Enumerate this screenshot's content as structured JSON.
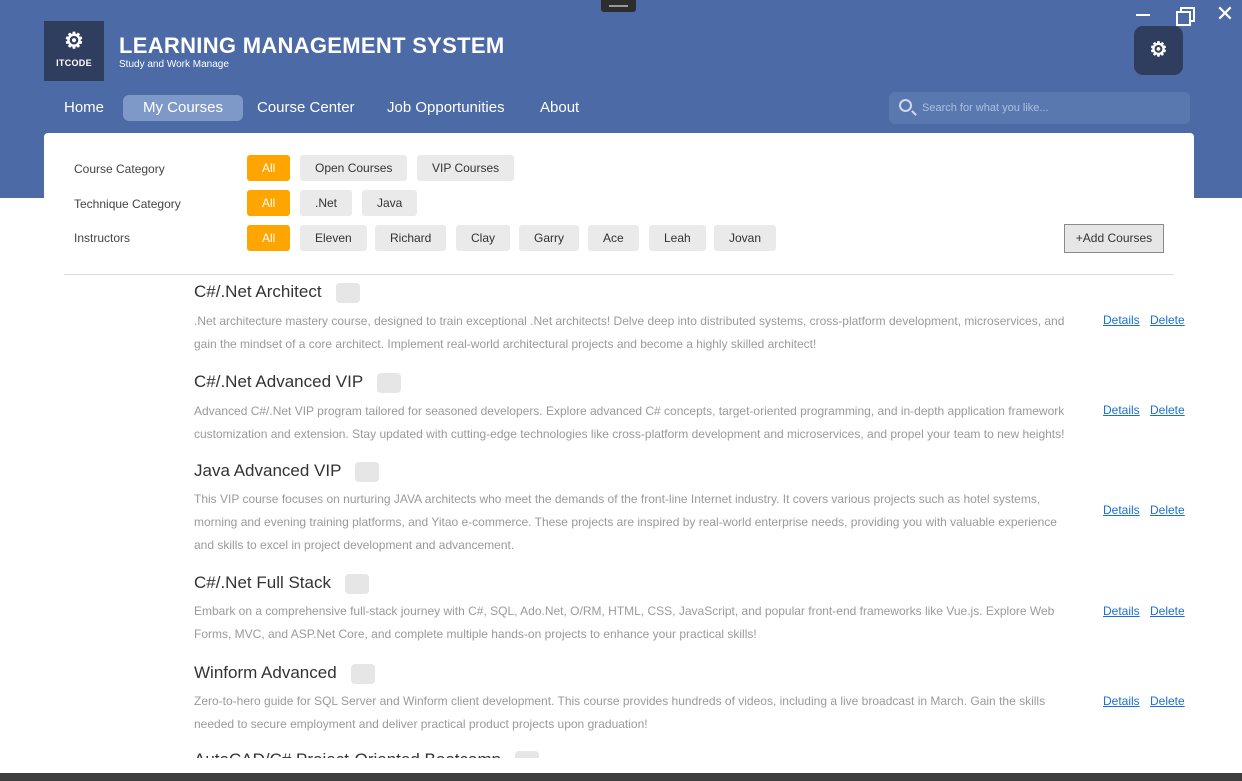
{
  "window": {
    "close_glyph": "✕"
  },
  "header": {
    "logo_glyph": "⚙",
    "logo_text": "ITCODE",
    "title": "LEARNING MANAGEMENT SYSTEM",
    "subtitle": "Study and Work Manage",
    "avatar_glyph": "⚙"
  },
  "nav": {
    "home": "Home",
    "my_courses": "My Courses",
    "course_center": "Course Center",
    "job_opportunities": "Job Opportunities",
    "about": "About"
  },
  "search": {
    "placeholder": "Search for what you like..."
  },
  "filters": {
    "course_category": {
      "label": "Course Category",
      "options": [
        "All",
        "Open Courses",
        "VIP Courses"
      ],
      "selected": "All"
    },
    "technique_category": {
      "label": "Technique Category",
      "options": [
        "All",
        ".Net",
        "Java"
      ],
      "selected": "All"
    },
    "instructors": {
      "label": "Instructors",
      "options": [
        "All",
        "Eleven",
        "Richard",
        "Clay",
        "Garry",
        "Ace",
        "Leah",
        "Jovan"
      ],
      "selected": "All"
    }
  },
  "add_courses_label": "+Add Courses",
  "courses": [
    {
      "title": "C#/.Net Architect",
      "desc_lines": [
        ".Net architecture mastery course, designed to train exceptional .Net architects! Delve deep into distributed systems, cross-platform development, microservices, and",
        "gain the mindset of a core architect. Implement real-world architectural projects and become a highly skilled architect!"
      ],
      "details": "Details",
      "delete": "Delete"
    },
    {
      "title": "C#/.Net Advanced VIP",
      "desc_lines": [
        "Advanced C#/.Net VIP program tailored for seasoned developers. Explore advanced C# concepts, target-oriented programming, and in-depth application framework",
        "customization and extension. Stay updated with cutting-edge technologies like cross-platform development and microservices, and propel your team to new heights!"
      ],
      "details": "Details",
      "delete": "Delete"
    },
    {
      "title": "Java Advanced VIP",
      "desc_lines": [
        "This VIP course focuses on nurturing JAVA architects who meet the demands of the front-line Internet industry. It covers various projects such as hotel systems,",
        "morning and evening training platforms, and Yitao e-commerce. These projects are inspired by real-world enterprise needs, providing you with valuable experience",
        "and skills to excel in project development and advancement."
      ],
      "details": "Details",
      "delete": "Delete"
    },
    {
      "title": "C#/.Net Full Stack",
      "desc_lines": [
        "Embark on a comprehensive full-stack journey with C#, SQL, Ado.Net, O/RM, HTML, CSS, JavaScript, and popular front-end frameworks like Vue.js. Explore Web",
        "Forms, MVC, and ASP.Net Core, and complete multiple hands-on projects to enhance your practical skills!"
      ],
      "details": "Details",
      "delete": "Delete"
    },
    {
      "title": "Winform Advanced",
      "desc_lines": [
        "Zero-to-hero guide for SQL Server and Winform client development. This course provides hundreds of videos, including a live broadcast in March. Gain the skills",
        "needed to secure employment and deliver practical product projects upon graduation!"
      ],
      "details": "Details",
      "delete": "Delete"
    },
    {
      "title": "AutoCAD/C# Project-Oriented Bootcamp"
    }
  ],
  "colors": {
    "header_bg": "#4b6aa6",
    "accent": "#ffa500",
    "link": "#1b6ed6"
  }
}
